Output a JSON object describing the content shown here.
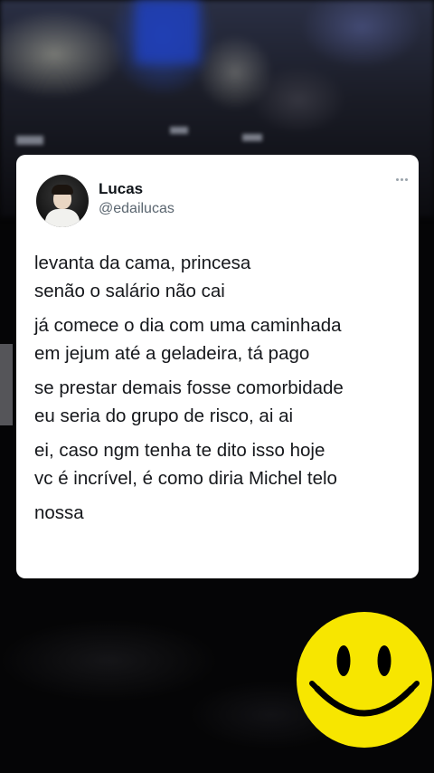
{
  "tweet": {
    "author_name": "Lucas",
    "author_handle": "@edailucas",
    "paragraphs": [
      {
        "lines": [
          "levanta da cama, princesa",
          "senão o salário não cai"
        ]
      },
      {
        "lines": [
          "já comece o dia com uma caminhada",
          "em jejum até a geladeira, tá pago"
        ]
      },
      {
        "lines": [
          "se prestar demais fosse comorbidade",
          "eu seria do grupo de risco, ai ai"
        ]
      },
      {
        "lines": [
          "ei, caso ngm tenha te dito isso hoje",
          "vc é incrível, é como diria Michel telo"
        ]
      },
      {
        "lines": [
          "nossa"
        ]
      }
    ]
  },
  "icons": {
    "more": "more-icon",
    "avatar": "avatar",
    "sticker": "smiley-icon"
  },
  "colors": {
    "card_background": "#ffffff",
    "text": "#16181c",
    "handle_text": "#5b6670",
    "page_background": "#050506",
    "smiley_yellow": "#f7e600"
  }
}
